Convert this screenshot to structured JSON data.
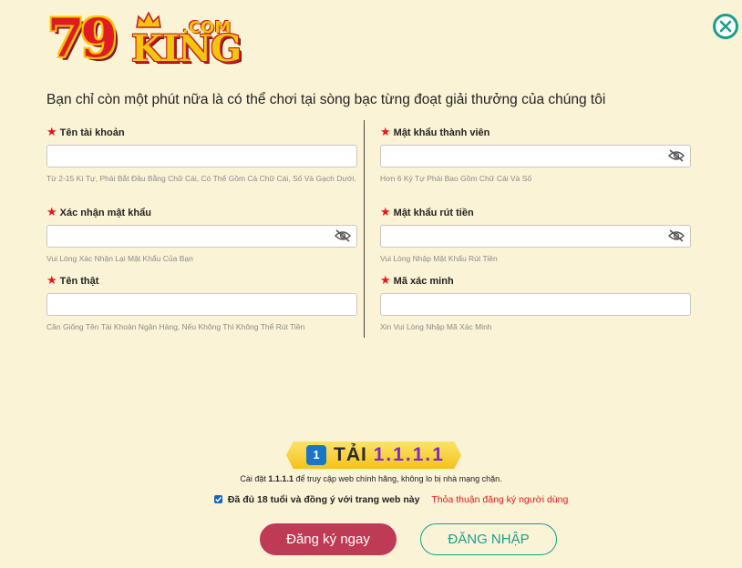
{
  "logo": {
    "number": "79",
    "word": "KING",
    "suffix": ".COM"
  },
  "intro": "Bạn chỉ còn một phút nữa là có thể chơi tại sòng bạc từng đoạt giải thưởng của chúng tôi",
  "fields": {
    "username": {
      "label": "Tên tài khoản",
      "help": "Từ 2-15 Kí Tự, Phải Bắt Đầu Bằng Chữ Cái, Có Thể Gồm Cả Chữ Cái, Số Và Gạch Dưới.",
      "value": ""
    },
    "password": {
      "label": "Mật khẩu thành viên",
      "help": "Hơn 6 Ký Tự Phải Bao Gồm Chữ Cái Và Số",
      "value": ""
    },
    "confirm_password": {
      "label": "Xác nhận mật khẩu",
      "help": "Vui Lòng Xác Nhận Lại Mật Khẩu Của Bạn",
      "value": ""
    },
    "withdraw_password": {
      "label": "Mật khẩu rút tiền",
      "help": "Vui Lòng Nhập Mật Khẩu Rút Tiền",
      "value": ""
    },
    "real_name": {
      "label": "Tên thật",
      "help": "Cần Giống Tên Tài Khoản Ngân Hàng, Nếu Không Thì Không Thể Rút Tiền",
      "value": ""
    },
    "captcha": {
      "label": "Mã xác minh",
      "help": "Xin Vui Lòng Nhập Mã Xác Minh",
      "value": ""
    }
  },
  "download": {
    "badge": "1",
    "label": "TẢI",
    "version": "1.1.1.1"
  },
  "install_note": {
    "prefix": "Cài đặt",
    "app": "1.1.1.1",
    "suffix": "để truy cập web chính hãng, không lo bị nhà mạng chặn."
  },
  "agree": {
    "checked": true,
    "text": "Đã đủ 18 tuổi và đồng ý với trang web này",
    "link": "Thỏa thuận đăng ký người dùng"
  },
  "buttons": {
    "register": "Đăng ký ngay",
    "login": "ĐĂNG NHẬP"
  },
  "colors": {
    "background": "#fbf3d6",
    "accent": "#1a9e8c",
    "register": "#bf3a55",
    "required_star": "#e01818"
  },
  "icons": {
    "close": "close-circle-icon",
    "eye": "eye-slash-icon",
    "check": "checkbox-checked-icon",
    "star": "required-star-icon"
  }
}
